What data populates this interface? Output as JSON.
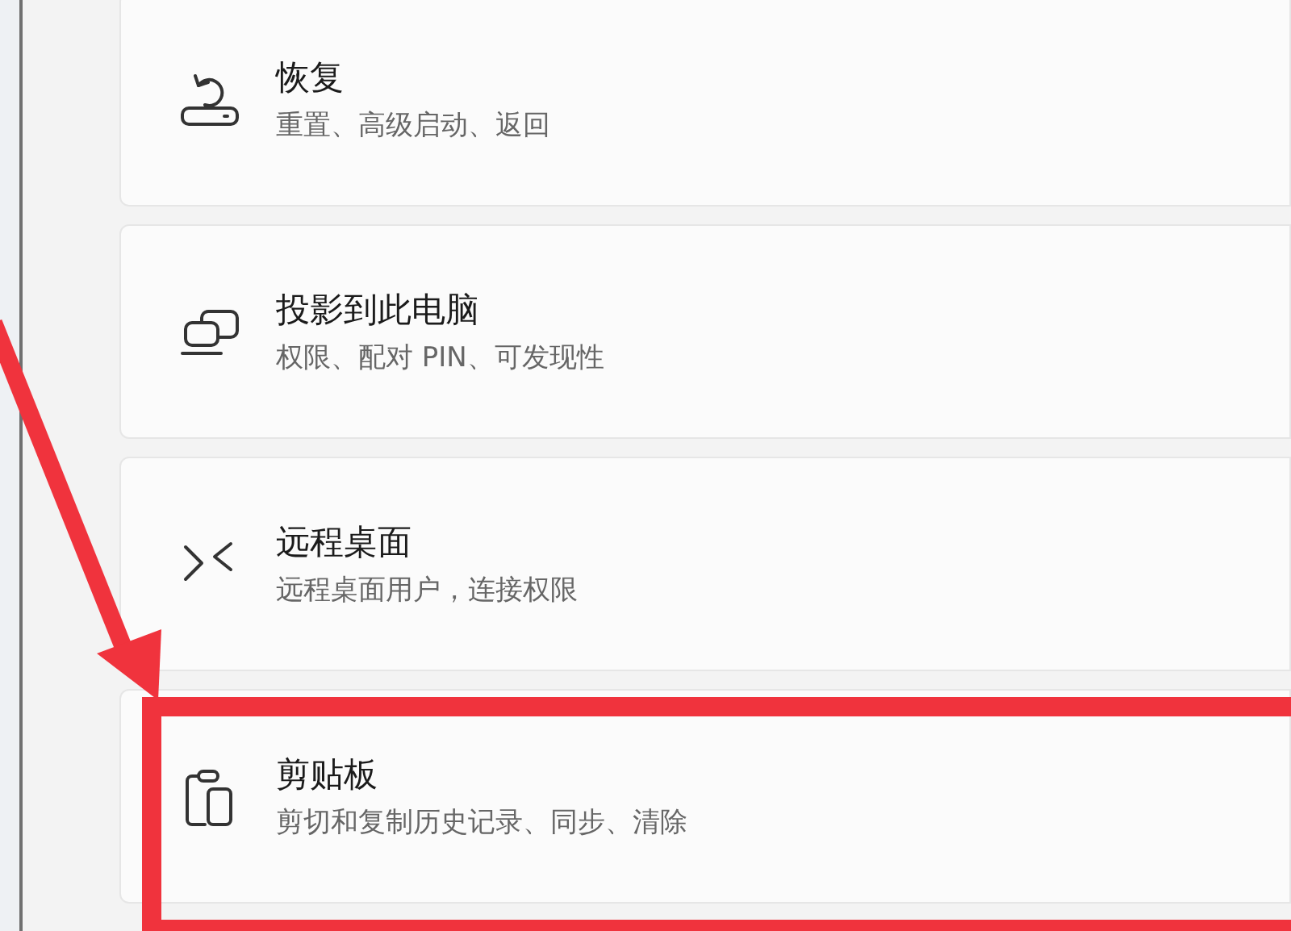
{
  "settings_items": [
    {
      "kind": "recovery",
      "title": "恢复",
      "subtitle": "重置、高级启动、返回",
      "highlighted": false
    },
    {
      "kind": "project",
      "title": "投影到此电脑",
      "subtitle": "权限、配对 PIN、可发现性",
      "highlighted": false
    },
    {
      "kind": "remote",
      "title": "远程桌面",
      "subtitle": "远程桌面用户，连接权限",
      "highlighted": false
    },
    {
      "kind": "clipboard",
      "title": "剪贴板",
      "subtitle": "剪切和复制历史记录、同步、清除",
      "highlighted": true
    }
  ]
}
